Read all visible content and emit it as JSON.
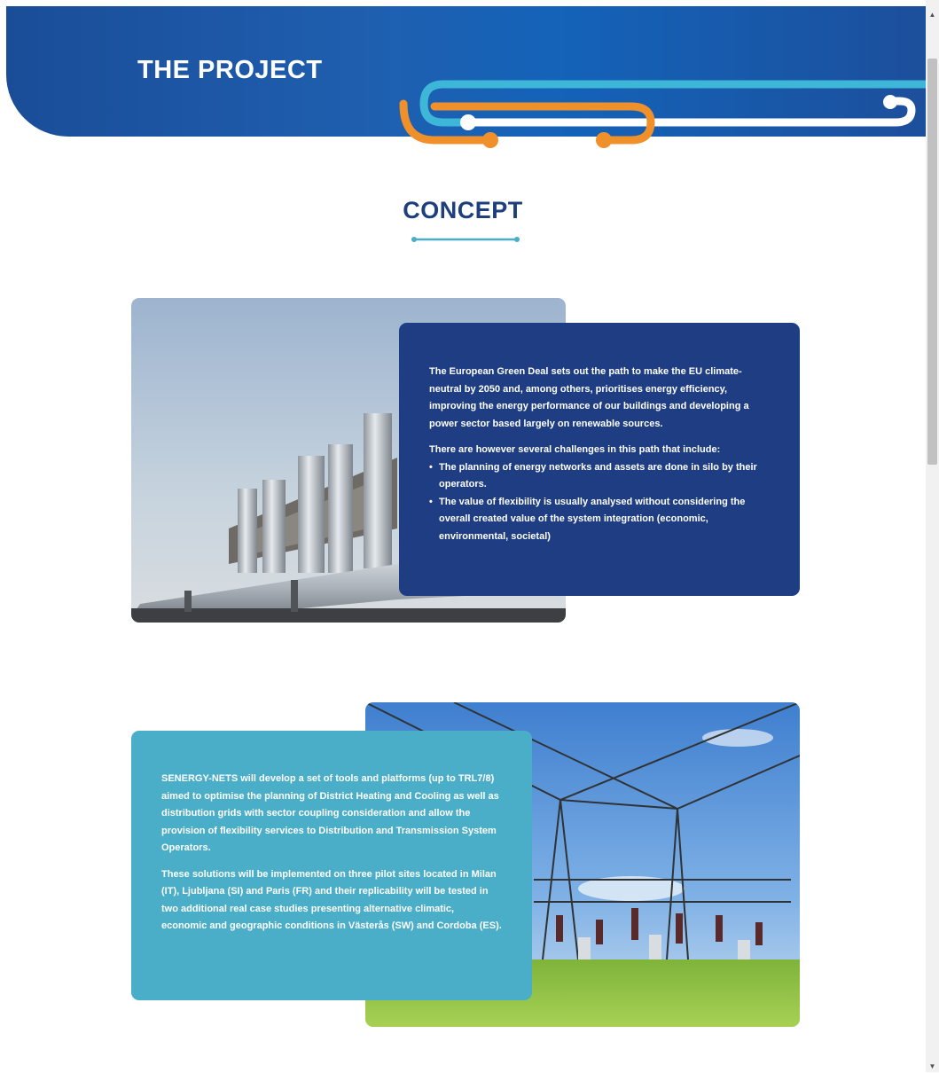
{
  "header": {
    "title": "THE PROJECT"
  },
  "section": {
    "title": "CONCEPT"
  },
  "block1": {
    "paragraph1": "The European Green Deal sets out the path to make the EU climate-neutral by 2050 and, among others, prioritises energy efficiency, improving the energy performance of our buildings and developing a power sector based largely on renewable sources.",
    "paragraph2": "There are however several challenges in this path that include:",
    "bullets": [
      "The planning of energy networks and assets are done in silo by their operators.",
      "The value of flexibility is usually analysed without considering the overall created value of the system integration (economic, environmental, societal)"
    ]
  },
  "block2": {
    "paragraph1": "SENERGY-NETS will develop a set of tools and platforms (up to TRL7/8) aimed to optimise the planning of District Heating and Cooling as well as distribution grids with sector coupling consideration and allow the provision of flexibility services to Distribution and Transmission System Operators.",
    "paragraph2": "These solutions will be implemented on three pilot sites located in Milan (IT), Ljubljana (SI) and Paris (FR) and their replicability will be tested in two additional real case studies presenting alternative climatic, economic and geographic conditions in Västerås (SW) and Cordoba (ES)."
  },
  "colors": {
    "banner": "#1a4d98",
    "orange": "#f0902a",
    "teal": "#4aaec8",
    "navy": "#1e3d82"
  },
  "icons": {
    "scroll_up": "chevron-up-icon",
    "scroll_down": "chevron-down-icon"
  }
}
